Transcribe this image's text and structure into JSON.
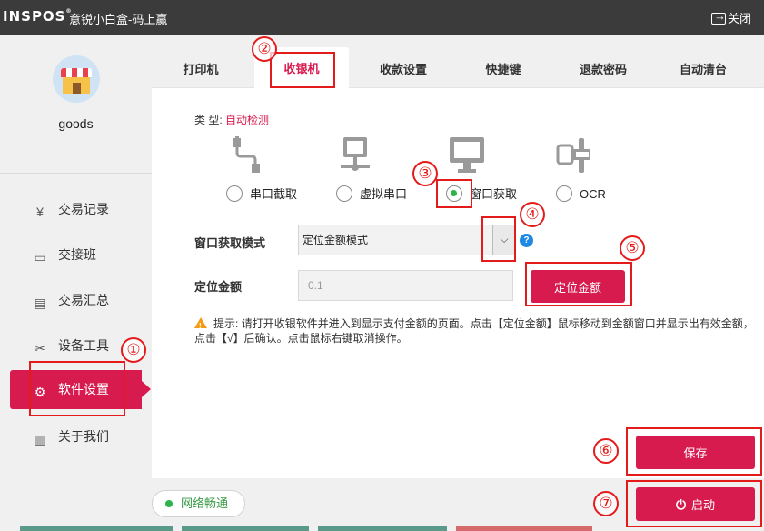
{
  "titlebar": {
    "logo": "INSPOS",
    "title": "意锐小白盒-码上赢",
    "close_label": "关闭"
  },
  "user": {
    "name": "goods"
  },
  "sidebar": {
    "items": [
      {
        "label": "交易记录",
        "icon": "yuan-receipt-icon"
      },
      {
        "label": "交接班",
        "icon": "monitor-icon"
      },
      {
        "label": "交易汇总",
        "icon": "document-icon"
      },
      {
        "label": "设备工具",
        "icon": "tools-icon"
      },
      {
        "label": "软件设置",
        "icon": "gear-icon",
        "active": true
      },
      {
        "label": "关于我们",
        "icon": "info-book-icon"
      }
    ]
  },
  "network": {
    "label": "网络畅通",
    "color": "#2cb44a"
  },
  "tabs": [
    {
      "label": "打印机"
    },
    {
      "label": "收银机",
      "active": true
    },
    {
      "label": "收款设置"
    },
    {
      "label": "快捷键"
    },
    {
      "label": "退款密码"
    },
    {
      "label": "自动清台"
    }
  ],
  "type_row": {
    "label": "类 型:",
    "link": "自动检测"
  },
  "options": [
    {
      "label": "串口截取",
      "icon": "serial-cable-icon",
      "selected": false
    },
    {
      "label": "虚拟串口",
      "icon": "network-computer-icon",
      "selected": false
    },
    {
      "label": "窗口获取",
      "icon": "monitor-icon",
      "selected": true
    },
    {
      "label": "OCR",
      "icon": "ocr-scan-icon",
      "selected": false
    }
  ],
  "window_mode": {
    "label": "窗口获取模式",
    "value": "定位金额模式"
  },
  "locate_amount": {
    "label": "定位金额",
    "value": "0.1",
    "button": "定位金额"
  },
  "tip": {
    "prefix": "提示:",
    "text": "请打开收银软件并进入到显示支付金额的页面。点击【定位金额】鼠标移动到金额窗口并显示出有效金额，点击【√】后确认。点击鼠标右键取消操作。"
  },
  "buttons": {
    "save": "保存",
    "start": "启动"
  },
  "annotations": [
    "①",
    "②",
    "③",
    "④",
    "⑤",
    "⑥",
    "⑦"
  ],
  "colors": {
    "accent": "#d81b4f",
    "annotation": "#e41b1b",
    "titlebar": "#3b3b3b"
  }
}
